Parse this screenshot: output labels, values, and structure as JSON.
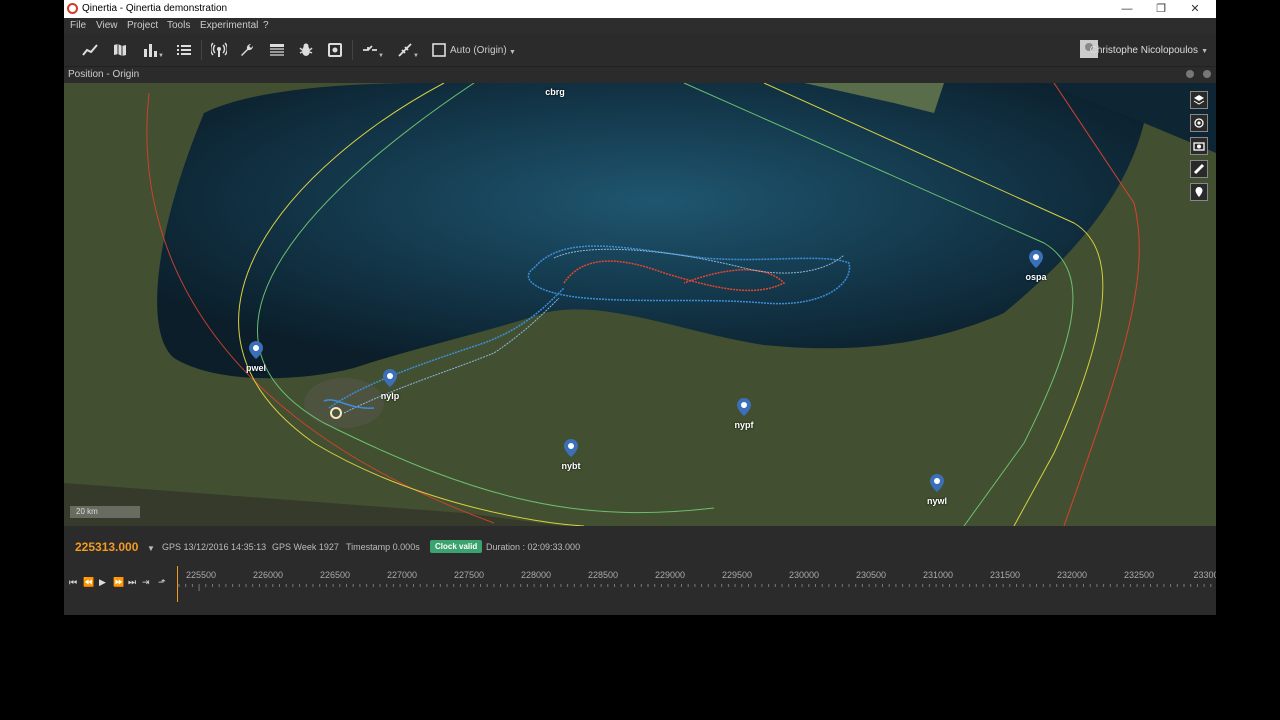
{
  "window": {
    "title": "Qinertia - Qinertia demonstration"
  },
  "menu": [
    "File",
    "View",
    "Project",
    "Tools",
    "Experimental",
    "?"
  ],
  "toolbar": {
    "tools": [
      "line-chart-icon",
      "map-icon",
      "bar-chart-icon",
      "list-icon",
      "antenna-icon",
      "wrench-icon",
      "table-icon",
      "bug-icon",
      "chip-icon",
      "processing-icon",
      "trajectory-icon",
      "checkbox-icon"
    ],
    "auto_label": "Auto (Origin)"
  },
  "user": {
    "name": "Christophe Nicolopoulos"
  },
  "panel": {
    "title": "Position - Origin"
  },
  "map": {
    "stations": [
      {
        "name": "cbrg",
        "id": "cbrg",
        "pin": false
      },
      {
        "name": "ospa",
        "id": "ospa",
        "pin": true
      },
      {
        "name": "pwel",
        "id": "pwel",
        "pin": true
      },
      {
        "name": "nylp",
        "id": "nylp",
        "pin": true
      },
      {
        "name": "nypf",
        "id": "nypf",
        "pin": true
      },
      {
        "name": "nybt",
        "id": "nybt",
        "pin": true
      },
      {
        "name": "nywl",
        "id": "nywl",
        "pin": true
      }
    ],
    "scale_label": "20 km",
    "tools": [
      "layers-icon",
      "locate-icon",
      "camera-icon",
      "ruler-icon",
      "marker-icon"
    ]
  },
  "status": {
    "time": "225313.000",
    "gps_date": "GPS 13/12/2016 14:35:13",
    "gps_week": "GPS Week 1927",
    "timestamp": "Timestamp 0.000s",
    "clock": "Clock valid",
    "duration": "Duration : 02:09:33.000"
  },
  "timeline": {
    "ticks": [
      "225500",
      "226000",
      "226500",
      "227000",
      "227500",
      "228000",
      "228500",
      "229000",
      "229500",
      "230000",
      "230500",
      "231000",
      "231500",
      "232000",
      "232500",
      "23300"
    ]
  },
  "colors": {
    "accent": "#f39a21",
    "clock_valid": "#3aa36e",
    "track_blue": "#3b8fd9",
    "track_red": "#e8452c"
  }
}
